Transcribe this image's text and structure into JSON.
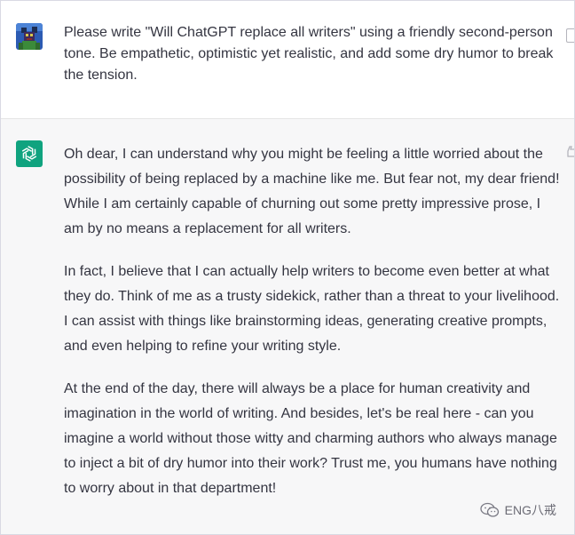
{
  "conversation": {
    "user": {
      "avatar": "pixel-art-avatar",
      "message": "Please write \"Will ChatGPT replace all writers\" using a friendly second-person tone. Be empathetic, optimistic yet realistic, and add some dry humor to break the tension."
    },
    "assistant": {
      "avatar": "openai-logo-icon",
      "paragraphs": [
        "Oh dear, I can understand why you might be feeling a little worried about the possibility of being replaced by a machine like me. But fear not, my dear friend! While I am certainly capable of churning out some pretty impressive prose, I am by no means a replacement for all writers.",
        "In fact, I believe that I can actually help writers to become even better at what they do. Think of me as a trusty sidekick, rather than a threat to your livelihood. I can assist with things like brainstorming ideas, generating creative prompts, and even helping to refine your writing style.",
        "At the end of the day, there will always be a place for human creativity and imagination in the world of writing. And besides, let's be real here - can you imagine a world without those witty and charming authors who always manage to inject a bit of dry humor into their work? Trust me, you humans have nothing to worry about in that department!"
      ]
    }
  },
  "watermark": {
    "text": "ENG八戒",
    "icon": "wechat-icon"
  },
  "colors": {
    "assistant_bg": "#f7f7f8",
    "openai_green": "#10a37f",
    "text": "#343541"
  }
}
